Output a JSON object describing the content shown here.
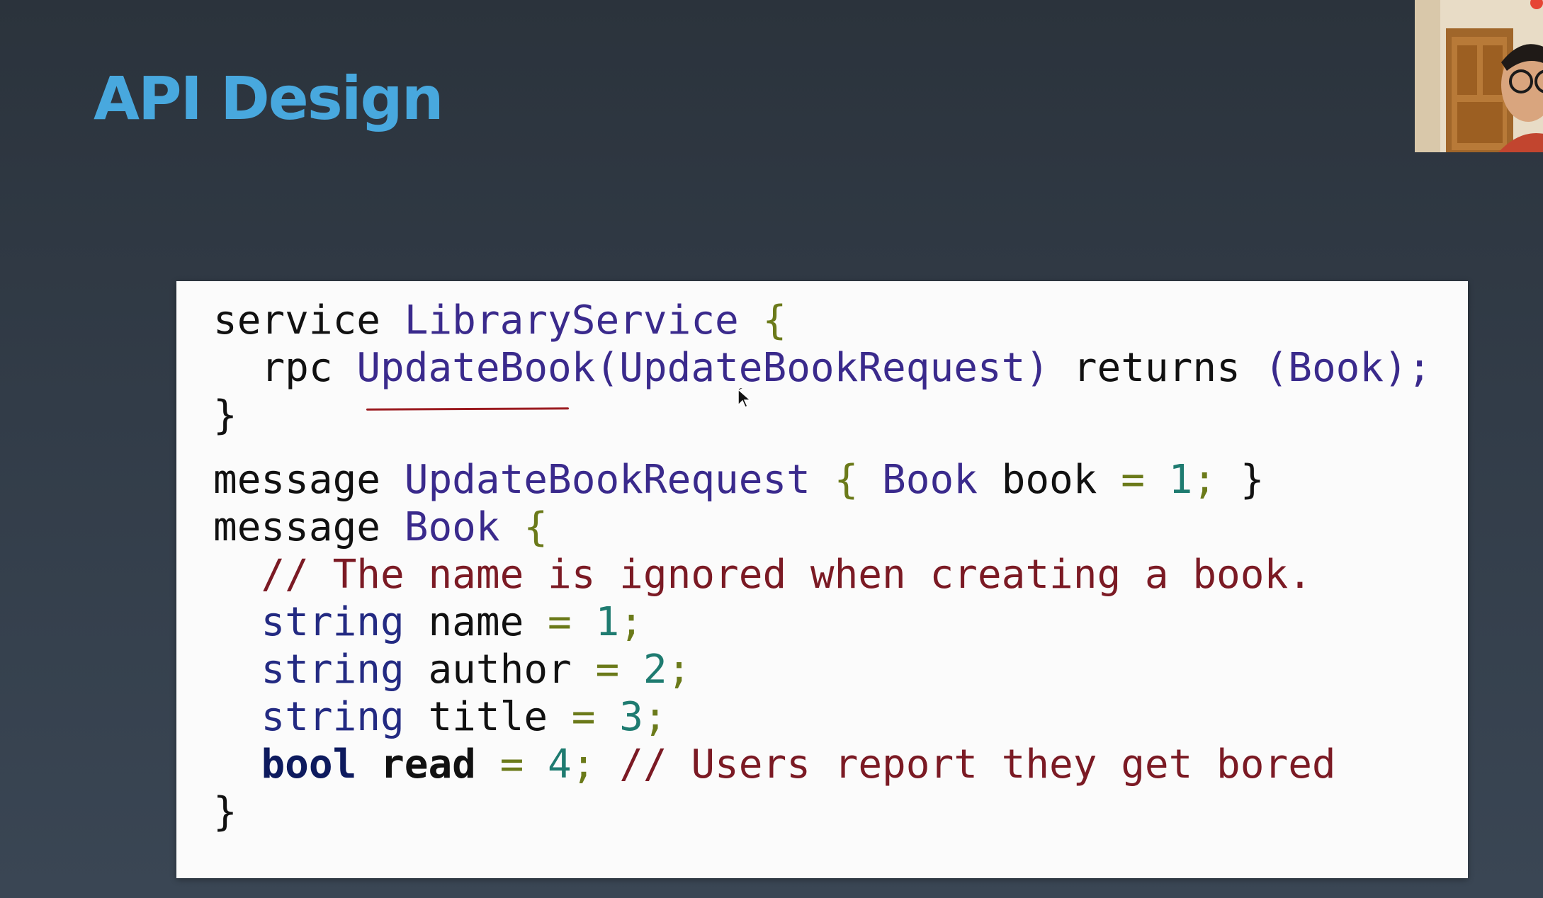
{
  "slide": {
    "title": "API Design"
  },
  "code": {
    "service_kw": "service",
    "service_name": "LibraryService",
    "open_brace": "{",
    "close_brace": "}",
    "rpc_kw": "rpc",
    "rpc_name": "UpdateBook",
    "rpc_args": "(UpdateBookRequest)",
    "returns_kw": "returns",
    "rpc_return": "(Book);",
    "message_kw": "message",
    "req_name": "UpdateBookRequest",
    "req_field_type": "Book",
    "req_field_name": "book",
    "equals": "=",
    "num_1": "1",
    "num_2": "2",
    "num_3": "3",
    "num_4": "4",
    "semicolon": ";",
    "book_name": "Book",
    "comment_name": "// The name is ignored when creating a book.",
    "type_string": "string",
    "type_bool": "bool",
    "field_name": "name",
    "field_author": "author",
    "field_title": "title",
    "field_read": "read",
    "comment_read": "// Users report they get bored"
  },
  "colors": {
    "title": "#48a8de",
    "background": "#2f3843",
    "panel": "#fbfbfb",
    "annotation": "#9b1b20"
  },
  "icons": {
    "cursor": "mouse-pointer-icon"
  }
}
